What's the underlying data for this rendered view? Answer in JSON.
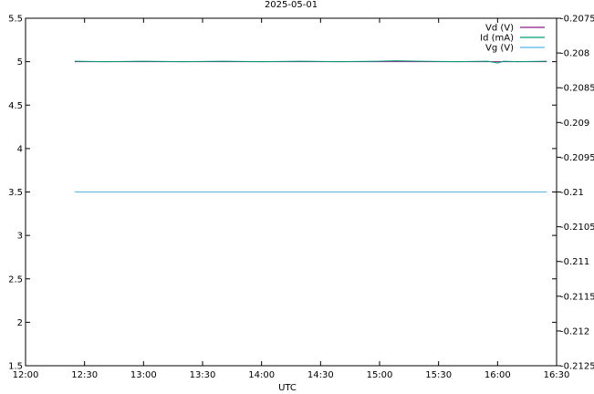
{
  "chart_data": {
    "type": "line",
    "title": "2025-05-01",
    "xlabel": "UTC",
    "ylabel": "",
    "y2label": "",
    "xlim": [
      "12:00",
      "16:30"
    ],
    "ylim": [
      1.5,
      5.5
    ],
    "y2lim": [
      -0.2125,
      -0.2075
    ],
    "x_ticks": [
      "12:00",
      "12:30",
      "13:00",
      "13:30",
      "14:00",
      "14:30",
      "15:00",
      "15:30",
      "16:00",
      "16:30"
    ],
    "y_ticks": [
      "1.5",
      "2",
      "2.5",
      "3",
      "3.5",
      "4",
      "4.5",
      "5",
      "5.5"
    ],
    "y2_ticks": [
      "-0.2125",
      "-0.212",
      "-0.2115",
      "-0.211",
      "-0.2105",
      "-0.21",
      "-0.2095",
      "-0.209",
      "-0.2085",
      "-0.208",
      "-0.2075"
    ],
    "grid": false,
    "legend_position": "top-right",
    "series": [
      {
        "name": "Vd (V)",
        "axis": "left",
        "color": "#8b1a8b",
        "x": [
          "12:25",
          "16:25"
        ],
        "y": [
          5.0,
          5.0
        ]
      },
      {
        "name": "Id (mA)",
        "axis": "left",
        "color": "#009e73",
        "x": [
          "12:25",
          "12:40",
          "13:00",
          "13:20",
          "13:40",
          "14:00",
          "14:20",
          "14:40",
          "15:00",
          "15:08",
          "15:20",
          "15:40",
          "15:55",
          "16:00",
          "16:03",
          "16:10",
          "16:25"
        ],
        "y": [
          5.005,
          5.0,
          5.005,
          5.0,
          5.005,
          5.0,
          5.005,
          5.0,
          5.005,
          5.01,
          5.005,
          5.0,
          5.005,
          4.985,
          5.005,
          5.0,
          5.005
        ]
      },
      {
        "name": "Vg (V)",
        "axis": "left",
        "color": "#56b4e9",
        "x": [
          "12:25",
          "16:25"
        ],
        "y": [
          3.5,
          3.5
        ]
      }
    ]
  }
}
